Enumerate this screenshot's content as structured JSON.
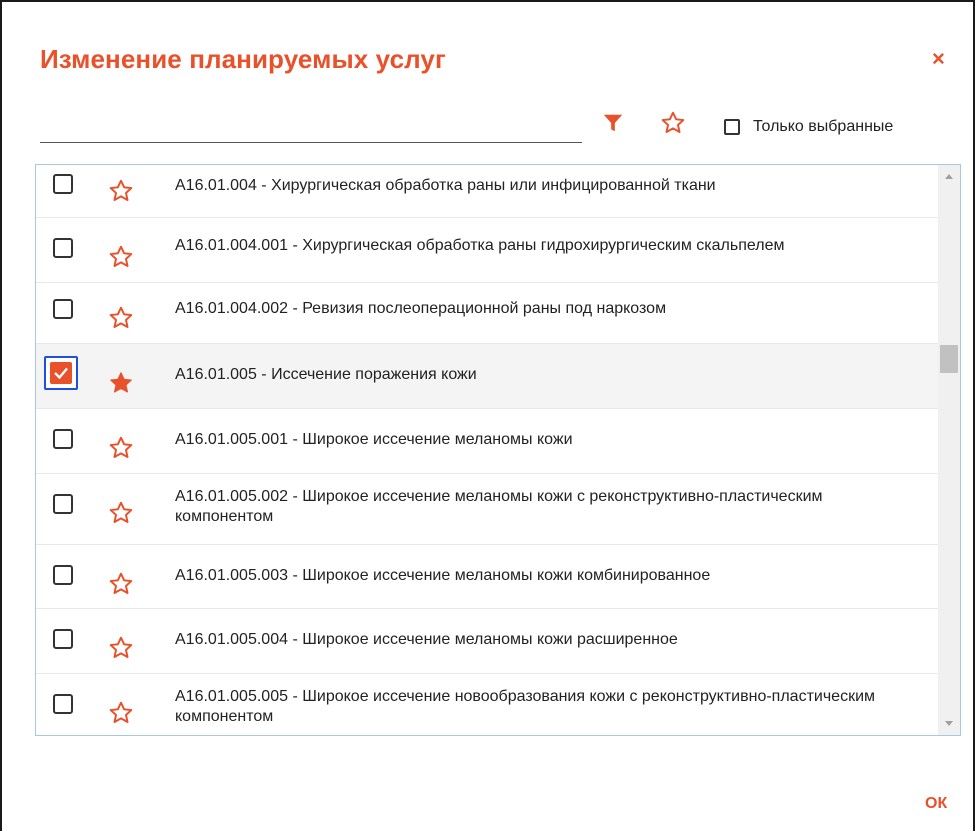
{
  "dialog": {
    "title": "Изменение планируемых услуг",
    "close_label": "×",
    "ok_label": "ОК"
  },
  "toolbar": {
    "search_value": "",
    "filter_icon": "filter-icon",
    "favorites_icon": "star-outline-icon",
    "only_selected_label": "Только выбранные",
    "only_selected_checked": false
  },
  "colors": {
    "accent": "#e8512a",
    "focus": "#1e4fe0",
    "list_border": "#a9c7de"
  },
  "services": [
    {
      "text": "А16.01.004 - Хирургическая обработка раны или инфицированной ткани",
      "checked": false,
      "favorite": false
    },
    {
      "text": "А16.01.004.001 - Хирургическая обработка раны гидрохирургическим скальпелем",
      "checked": false,
      "favorite": false
    },
    {
      "text": "А16.01.004.002 - Ревизия послеоперационной раны под наркозом",
      "checked": false,
      "favorite": false
    },
    {
      "text": "А16.01.005 - Иссечение поражения кожи",
      "checked": true,
      "favorite": true
    },
    {
      "text": "А16.01.005.001 - Широкое иссечение меланомы кожи",
      "checked": false,
      "favorite": false
    },
    {
      "text": "А16.01.005.002 - Широкое иссечение меланомы кожи с реконструктивно-пластическим компонентом",
      "checked": false,
      "favorite": false
    },
    {
      "text": "А16.01.005.003 - Широкое иссечение меланомы кожи комбинированное",
      "checked": false,
      "favorite": false
    },
    {
      "text": "А16.01.005.004 - Широкое иссечение меланомы кожи расширенное",
      "checked": false,
      "favorite": false
    },
    {
      "text": "А16.01.005.005 - Широкое иссечение новообразования кожи с реконструктивно-пластическим компонентом",
      "checked": false,
      "favorite": false
    }
  ]
}
